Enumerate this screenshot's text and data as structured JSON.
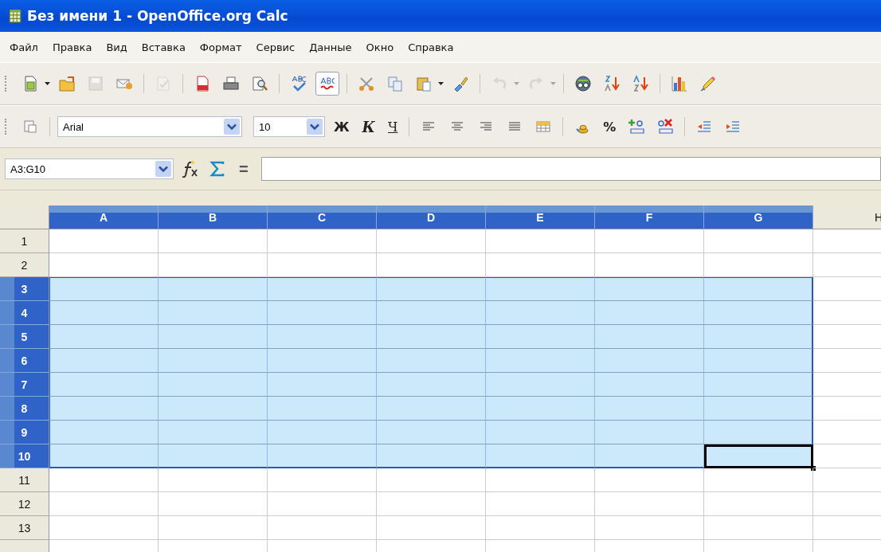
{
  "window": {
    "title": "Без имени 1 - OpenOffice.org Calc"
  },
  "menu": [
    "Файл",
    "Правка",
    "Вид",
    "Вставка",
    "Формат",
    "Сервис",
    "Данные",
    "Окно",
    "Справка"
  ],
  "standard_toolbar": [
    {
      "kind": "new",
      "disabled": false,
      "pressed": false,
      "dropdown": true
    },
    {
      "kind": "open",
      "disabled": false,
      "pressed": false,
      "dropdown": false
    },
    {
      "kind": "save",
      "disabled": true,
      "pressed": false,
      "dropdown": false
    },
    {
      "kind": "mail",
      "disabled": false,
      "pressed": false,
      "dropdown": false
    },
    {
      "kind": "sep"
    },
    {
      "kind": "edit",
      "disabled": true,
      "pressed": false,
      "dropdown": false
    },
    {
      "kind": "sep"
    },
    {
      "kind": "pdf",
      "disabled": false,
      "pressed": false,
      "dropdown": false
    },
    {
      "kind": "print",
      "disabled": false,
      "pressed": false,
      "dropdown": false
    },
    {
      "kind": "preview",
      "disabled": false,
      "pressed": false,
      "dropdown": false
    },
    {
      "kind": "sep"
    },
    {
      "kind": "spell",
      "disabled": false,
      "pressed": false,
      "dropdown": false
    },
    {
      "kind": "autospell",
      "disabled": false,
      "pressed": true,
      "dropdown": false
    },
    {
      "kind": "sep"
    },
    {
      "kind": "cut",
      "disabled": false,
      "pressed": false,
      "dropdown": false
    },
    {
      "kind": "copy",
      "disabled": false,
      "pressed": false,
      "dropdown": false
    },
    {
      "kind": "paste",
      "disabled": false,
      "pressed": false,
      "dropdown": true
    },
    {
      "kind": "brush",
      "disabled": false,
      "pressed": false,
      "dropdown": false
    },
    {
      "kind": "sep"
    },
    {
      "kind": "undo",
      "disabled": true,
      "pressed": false,
      "dropdown": true
    },
    {
      "kind": "redo",
      "disabled": true,
      "pressed": false,
      "dropdown": true
    },
    {
      "kind": "sep"
    },
    {
      "kind": "navigator",
      "disabled": false,
      "pressed": false,
      "dropdown": false
    },
    {
      "kind": "sortasc",
      "disabled": false,
      "pressed": false,
      "dropdown": false
    },
    {
      "kind": "sortdesc",
      "disabled": false,
      "pressed": false,
      "dropdown": false
    },
    {
      "kind": "sep"
    },
    {
      "kind": "chart",
      "disabled": false,
      "pressed": false,
      "dropdown": false
    },
    {
      "kind": "pencil",
      "disabled": false,
      "pressed": false,
      "dropdown": false
    }
  ],
  "formatting_toolbar": {
    "font": "Arial",
    "size": "10",
    "bold": "Ж",
    "italic": "К",
    "underline": "Ч",
    "percent": "%"
  },
  "formula_bar": {
    "name_box": "A3:G10",
    "equals": "="
  },
  "columns": [
    {
      "label": "A",
      "selected": true,
      "cursor": false
    },
    {
      "label": "B",
      "selected": true,
      "cursor": false
    },
    {
      "label": "C",
      "selected": true,
      "cursor": false
    },
    {
      "label": "D",
      "selected": true,
      "cursor": false
    },
    {
      "label": "E",
      "selected": true,
      "cursor": false
    },
    {
      "label": "F",
      "selected": true,
      "cursor": false
    },
    {
      "label": "G",
      "selected": true,
      "cursor": true
    },
    {
      "label": "H",
      "selected": false,
      "cursor": false
    }
  ],
  "rows": [
    {
      "label": "1",
      "selected": false,
      "cursor": false
    },
    {
      "label": "2",
      "selected": false,
      "cursor": false
    },
    {
      "label": "3",
      "selected": true,
      "cursor": false
    },
    {
      "label": "4",
      "selected": true,
      "cursor": false
    },
    {
      "label": "5",
      "selected": true,
      "cursor": false
    },
    {
      "label": "6",
      "selected": true,
      "cursor": false
    },
    {
      "label": "7",
      "selected": true,
      "cursor": false
    },
    {
      "label": "8",
      "selected": true,
      "cursor": false
    },
    {
      "label": "9",
      "selected": true,
      "cursor": false
    },
    {
      "label": "10",
      "selected": true,
      "cursor": true
    },
    {
      "label": "11",
      "selected": false,
      "cursor": false
    },
    {
      "label": "12",
      "selected": false,
      "cursor": false
    },
    {
      "label": "13",
      "selected": false,
      "cursor": false
    }
  ]
}
